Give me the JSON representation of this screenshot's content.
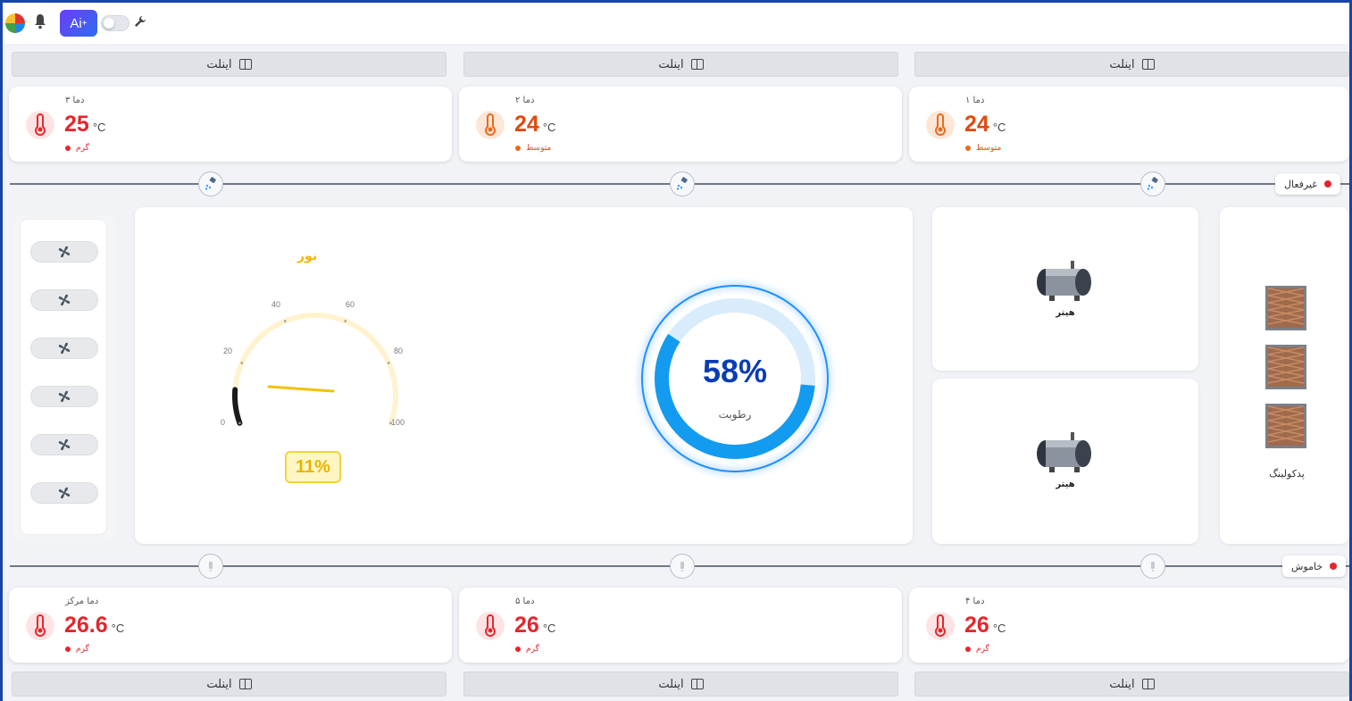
{
  "toolbar": {
    "ai_label": "Ai",
    "ai_sparkle": "+"
  },
  "inlets": {
    "label": "اینلت"
  },
  "temps_top": [
    {
      "label": "دما ۳",
      "value": "25",
      "unit": "°C",
      "status": "گرم",
      "color": "#e5262d"
    },
    {
      "label": "دما ۲",
      "value": "24",
      "unit": "°C",
      "status": "متوسط",
      "color": "#e04a12"
    },
    {
      "label": "دما ۱",
      "value": "24",
      "unit": "°C",
      "status": "متوسط",
      "color": "#e04a12"
    }
  ],
  "temps_bottom": [
    {
      "label": "دما مرکز",
      "value": "26.6",
      "unit": "°C",
      "status": "گرم",
      "color": "#e5262d"
    },
    {
      "label": "دما ۵",
      "value": "26",
      "unit": "°C",
      "status": "گرم",
      "color": "#e5262d"
    },
    {
      "label": "دما ۴",
      "value": "26",
      "unit": "°C",
      "status": "گرم",
      "color": "#e5262d"
    }
  ],
  "rail_top": {
    "status": "غیرفعال",
    "status_color": "#e5262d"
  },
  "rail_bottom": {
    "status": "خاموش",
    "status_color": "#e5262d"
  },
  "light": {
    "title": "نور",
    "value_text": "11%",
    "value": 11,
    "ticks": [
      "0",
      "20",
      "40",
      "60",
      "80",
      "100"
    ]
  },
  "humidity": {
    "value_text": "58%",
    "value": 58,
    "label": "رطوبت"
  },
  "heaters": [
    {
      "label": "هیتر"
    },
    {
      "label": "هیتر"
    }
  ],
  "pad_cooling": {
    "label": "پدکولینگ",
    "count": 3
  },
  "fans": {
    "count": 6
  }
}
